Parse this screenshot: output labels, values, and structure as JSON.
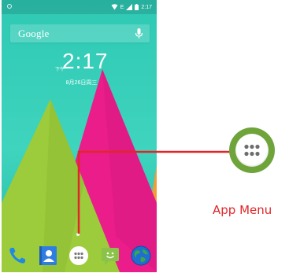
{
  "status_bar": {
    "time": "2:17",
    "network": "E"
  },
  "search": {
    "label": "Google"
  },
  "clock": {
    "ampm": "下午",
    "time": "2:17",
    "date": "8月26日周三"
  },
  "dock": {
    "icons": [
      "phone-icon",
      "contacts-icon",
      "app-menu-icon",
      "messaging-icon",
      "browser-icon"
    ]
  },
  "callout": {
    "label": "App Menu",
    "color": "#e1262a"
  },
  "colors": {
    "wallpaper_teal": "#2ec9b4",
    "wallpaper_pink": "#ea1d8a",
    "wallpaper_green": "#9ccb3b",
    "wallpaper_orange": "#f39c37",
    "app_menu_ring": "#6ea43a"
  }
}
